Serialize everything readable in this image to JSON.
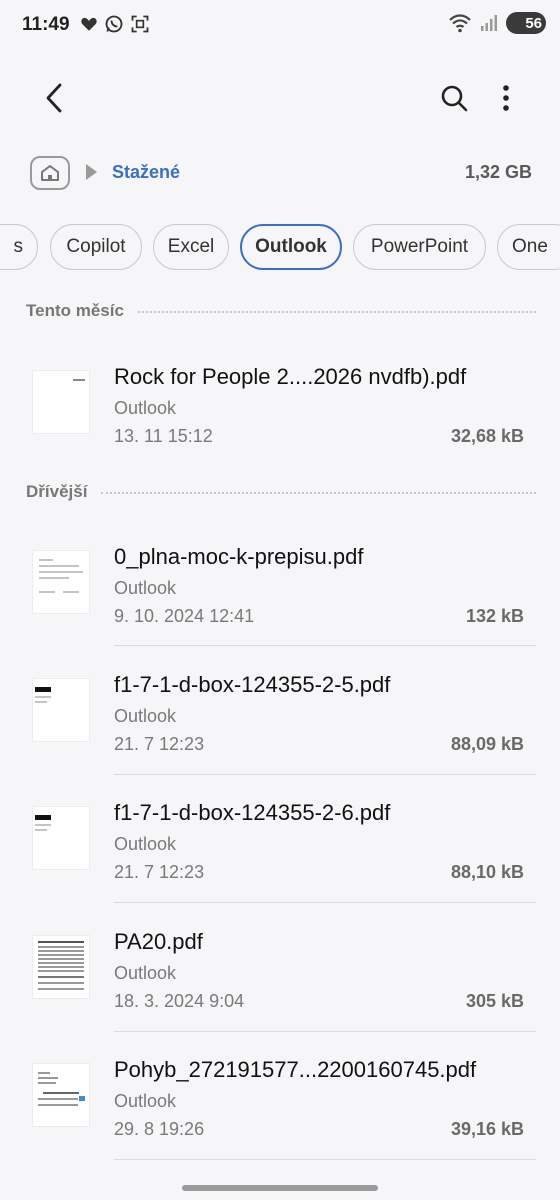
{
  "status_bar": {
    "time": "11:49",
    "battery": "56"
  },
  "breadcrumb": {
    "folder": "Stažené",
    "storage": "1,32 GB"
  },
  "chips": [
    {
      "label": "s"
    },
    {
      "label": "Copilot"
    },
    {
      "label": "Excel"
    },
    {
      "label": "Outlook",
      "selected": true
    },
    {
      "label": "PowerPoint"
    },
    {
      "label": "One"
    }
  ],
  "sections": {
    "this_month": "Tento měsíc",
    "earlier": "Dřívější"
  },
  "files": [
    {
      "name": "Rock for People 2....2026 nvdfb).pdf",
      "source": "Outlook",
      "date": "13. 11 15:12",
      "size": "32,68 kB"
    },
    {
      "name": "0_plna-moc-k-prepisu.pdf",
      "source": "Outlook",
      "date": "9. 10. 2024 12:41",
      "size": "132 kB"
    },
    {
      "name": "f1-7-1-d-box-124355-2-5.pdf",
      "source": "Outlook",
      "date": "21. 7 12:23",
      "size": "88,09 kB"
    },
    {
      "name": "f1-7-1-d-box-124355-2-6.pdf",
      "source": "Outlook",
      "date": "21. 7 12:23",
      "size": "88,10 kB"
    },
    {
      "name": "PA20.pdf",
      "source": "Outlook",
      "date": "18. 3. 2024 9:04",
      "size": "305 kB"
    },
    {
      "name": "Pohyb_272191577...2200160745.pdf",
      "source": "Outlook",
      "date": "29. 8 19:26",
      "size": "39,16 kB"
    }
  ],
  "colors": {
    "accent": "#3a6fc4",
    "background": "#f6f6f8"
  }
}
